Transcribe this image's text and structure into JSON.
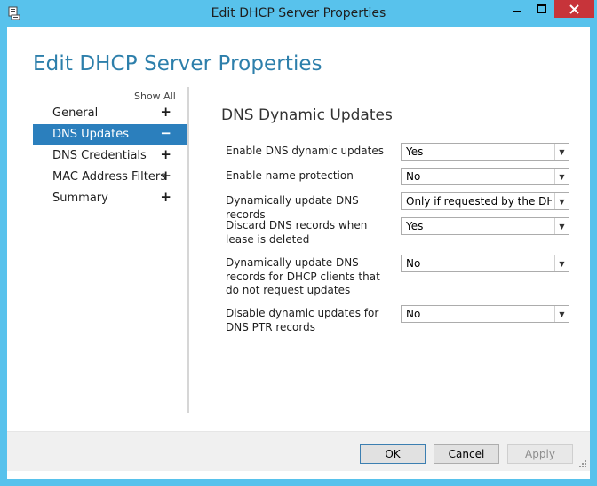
{
  "window": {
    "title": "Edit DHCP Server Properties"
  },
  "page": {
    "title": "Edit DHCP Server Properties"
  },
  "nav": {
    "show_all": "Show All",
    "items": [
      {
        "label": "General",
        "symbol": "+"
      },
      {
        "label": "DNS Updates",
        "symbol": "−"
      },
      {
        "label": "DNS Credentials",
        "symbol": "+"
      },
      {
        "label": "MAC Address Filters",
        "symbol": "+"
      },
      {
        "label": "Summary",
        "symbol": "+"
      }
    ]
  },
  "section": {
    "title": "DNS Dynamic Updates"
  },
  "settings": [
    {
      "label": "Enable DNS dynamic updates",
      "value": "Yes"
    },
    {
      "label": "Enable name protection",
      "value": "No"
    },
    {
      "label": "Dynamically update DNS records",
      "value": "Only if requested by the DHCP"
    },
    {
      "label": "Discard DNS records when lease is deleted",
      "value": "Yes"
    },
    {
      "label": "Dynamically update DNS records for DHCP clients that do not request updates",
      "value": "No"
    },
    {
      "label": "Disable dynamic updates for DNS PTR records",
      "value": "No"
    }
  ],
  "buttons": {
    "ok": "OK",
    "cancel": "Cancel",
    "apply": "Apply"
  },
  "colors": {
    "frame": "#58c2ec",
    "accent": "#2d7fab",
    "selected": "#2b7fbd",
    "close": "#c7343a"
  }
}
